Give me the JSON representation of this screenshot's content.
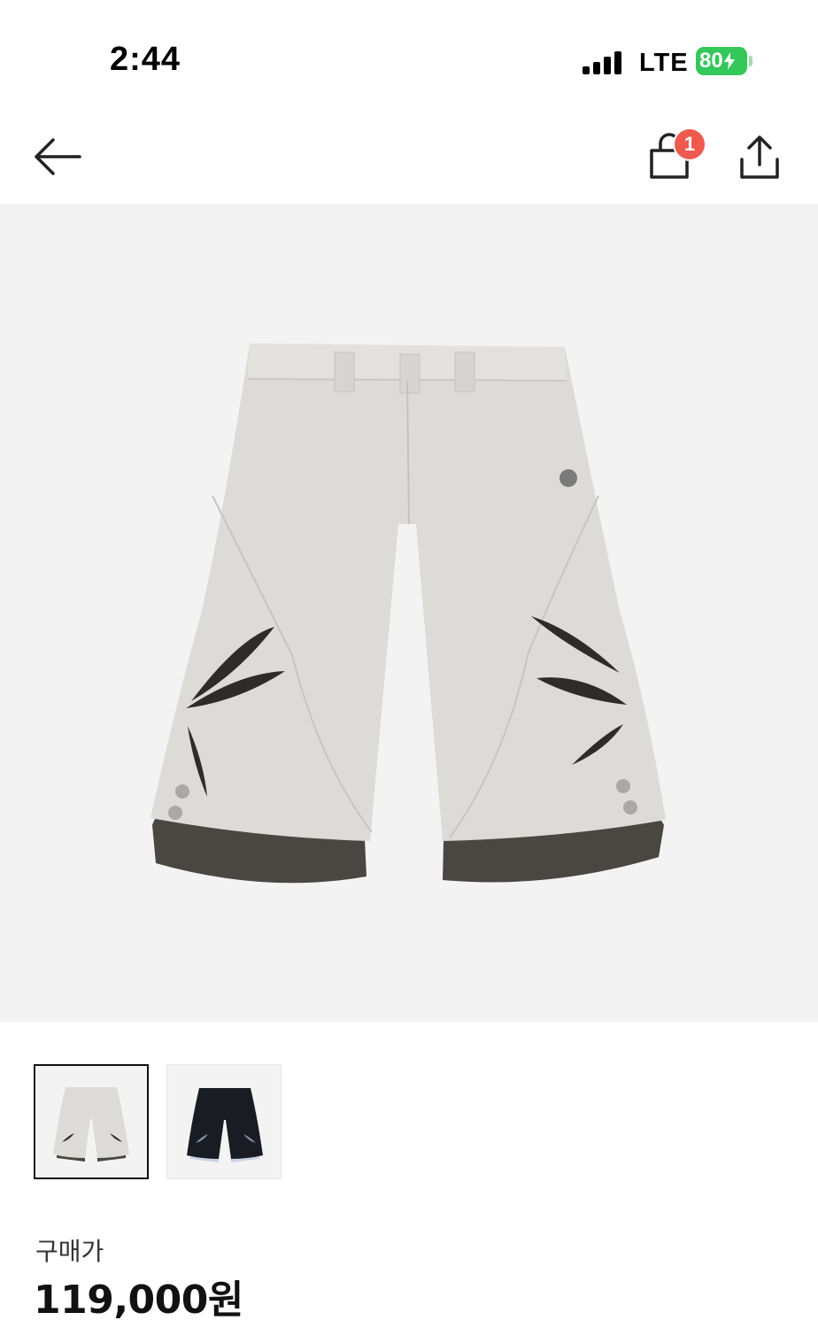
{
  "status_bar": {
    "time": "2:44",
    "network": "LTE",
    "battery": "80"
  },
  "nav": {
    "back_icon": "arrow-left-icon",
    "cart_icon": "shopping-bag-icon",
    "cart_count": "1",
    "share_icon": "share-icon"
  },
  "product": {
    "thumbnails": [
      {
        "icon": "shorts-light-grey-thumbnail",
        "selected": true
      },
      {
        "icon": "shorts-black-thumbnail",
        "selected": false
      }
    ],
    "price_label": "구매가",
    "price": "119,000원"
  },
  "colors": {
    "badge": "#ef5a4f",
    "battery": "#34c759",
    "hero_bg": "#f3f3f3"
  }
}
